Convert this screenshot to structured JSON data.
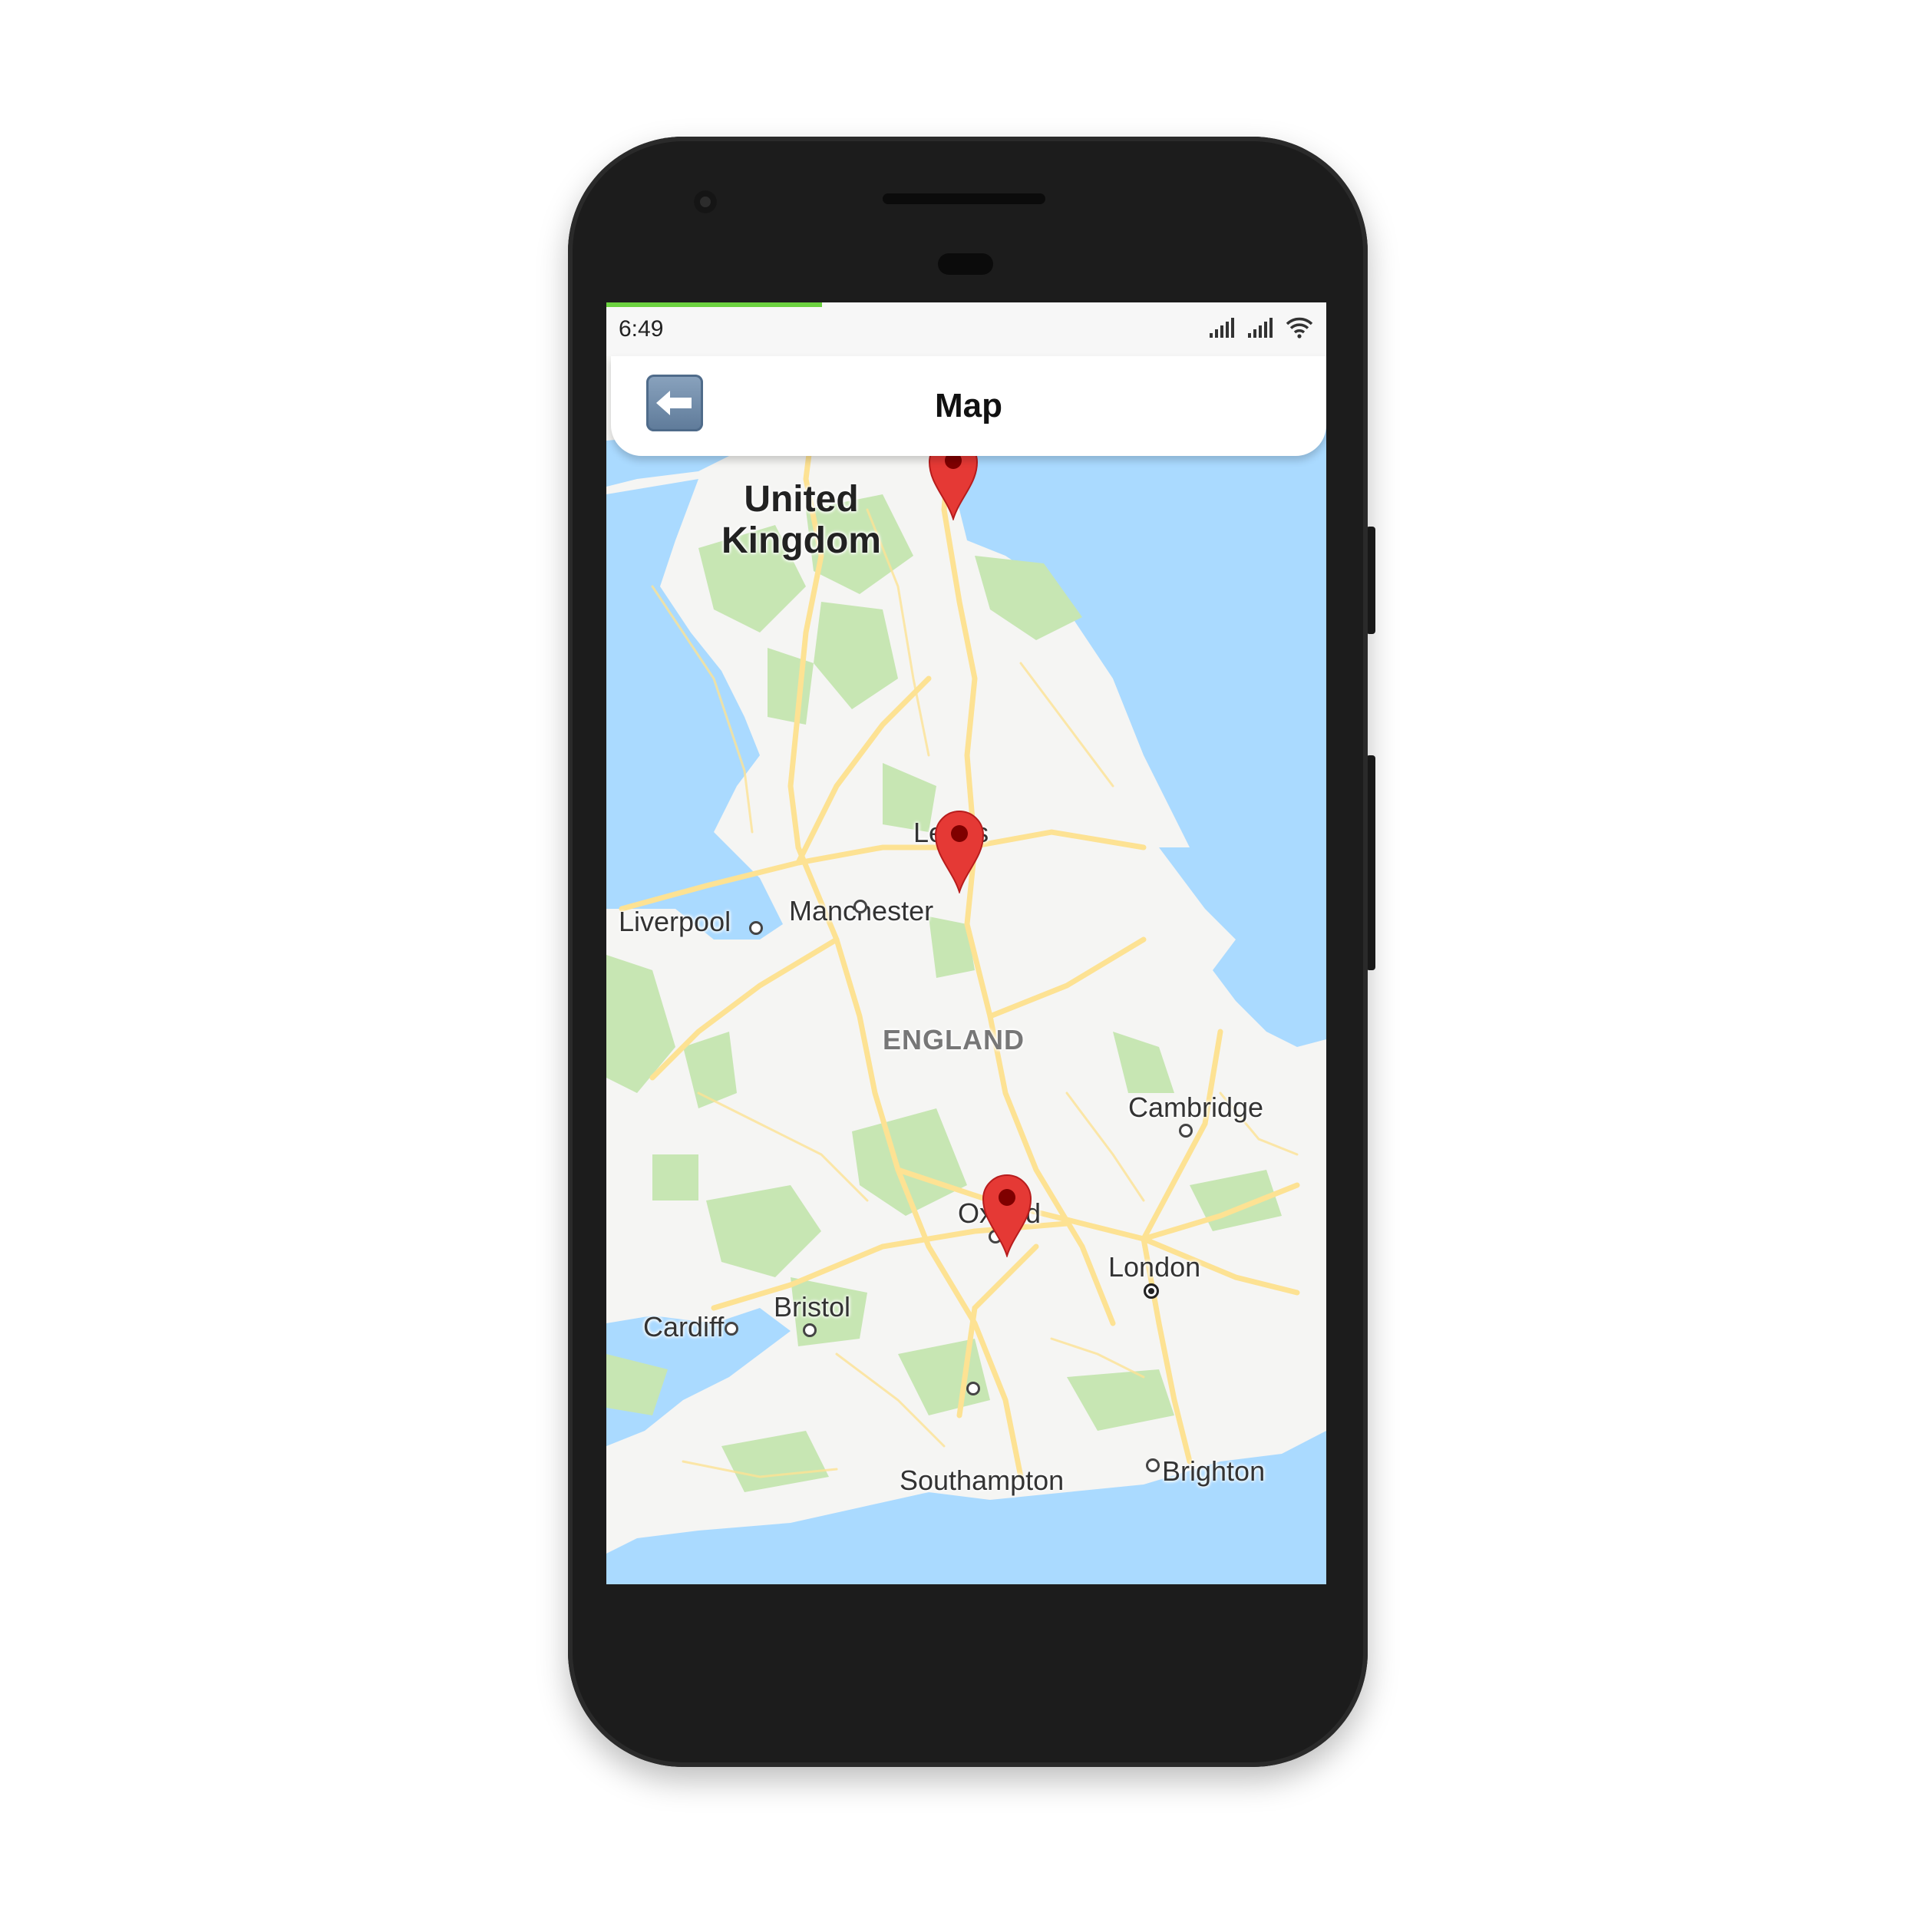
{
  "status_bar": {
    "time": "6:49",
    "icons": [
      "signal-icon",
      "signal-icon",
      "wifi-icon"
    ],
    "load_progress": 0.3
  },
  "header": {
    "back_icon": "back-arrow-icon",
    "title": "Map"
  },
  "map": {
    "country_label": "United Kingdom",
    "region_label": "ENGLAND",
    "cities": {
      "leeds": "Leeds",
      "manchester": "Manchester",
      "liverpool": "Liverpool",
      "cambridge": "Cambridge",
      "oxford": "Oxford",
      "london": "London",
      "cardiff": "Cardiff",
      "bristol": "Bristol",
      "southampton": "Southampton",
      "brighton": "Brighton"
    },
    "marker_icon": "map-pin-icon",
    "marker_color": "#e53935",
    "colors": {
      "water": "#aadaff",
      "land": "#f5f5f3",
      "park": "#c7e6b3",
      "road": "#fde293"
    }
  }
}
